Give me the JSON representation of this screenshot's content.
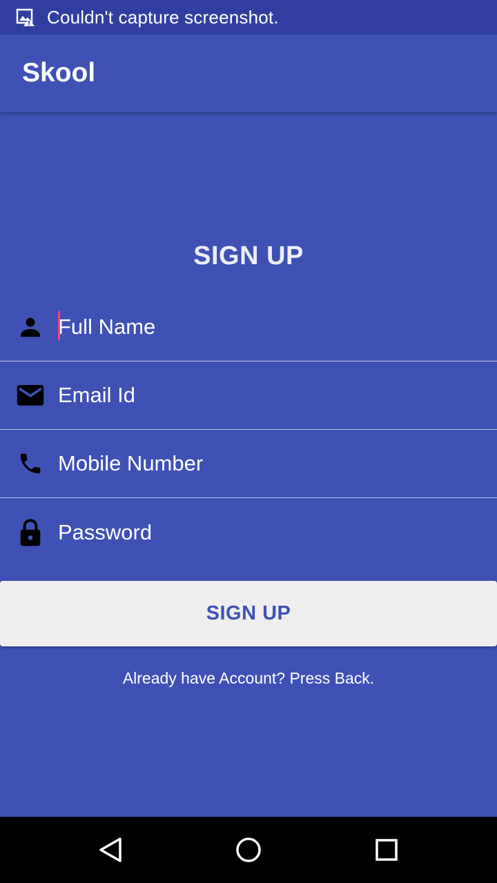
{
  "status_bar": {
    "message": "Couldn't capture screenshot.",
    "icon": "screenshot-error-icon"
  },
  "app_bar": {
    "title": "Skool"
  },
  "form": {
    "heading": "SIGN UP",
    "fields": [
      {
        "icon": "person-icon",
        "placeholder": "Full Name",
        "value": ""
      },
      {
        "icon": "email-icon",
        "placeholder": "Email Id",
        "value": ""
      },
      {
        "icon": "phone-icon",
        "placeholder": "Mobile Number",
        "value": ""
      },
      {
        "icon": "lock-icon",
        "placeholder": "Password",
        "value": ""
      }
    ],
    "submit_label": "SIGN UP",
    "back_hint": "Already have Account? Press Back."
  },
  "nav_bar": {
    "buttons": [
      "back-triangle-icon",
      "home-circle-icon",
      "recents-square-icon"
    ]
  },
  "colors": {
    "primary": "#3f51b5",
    "primary_dark": "#303f9f",
    "accent": "#ff4081",
    "button_bg": "#eeeeee"
  }
}
